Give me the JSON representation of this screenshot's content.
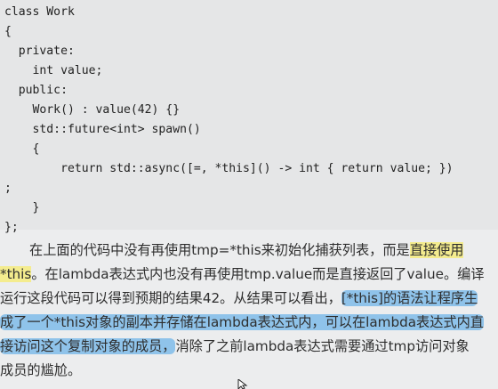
{
  "code": {
    "lines": [
      "class Work",
      "{",
      "  private:",
      "    int value;",
      "  public:",
      "    Work() : value(42) {}",
      "    std::future<int> spawn()",
      "    {",
      "        return std::async([=, *this]() -> int { return value; })",
      ";",
      "    }",
      "};"
    ]
  },
  "paragraph": {
    "l1_a": "在上面的代码中没有再使用tmp=*this来初始化捕获列表，而是",
    "l1_hl": "直接使用",
    "l2_hl": "*this",
    "l2_b": "。在lambda表达式内也没有再使用tmp.value而是直接返回了value。编译",
    "l3_a": "运行这段代码可以得到预期的结果42。从结果可以看出，",
    "l3_hl": "[*this]的语法让程序生",
    "l4_hl": "成了一个*this对象的副本并存储在lambda表达式内，可以在lambda表达式内直",
    "l5_hl": "接访问这个复制对象的成员，",
    "l5_b": "消除了之前lambda表达式需要通过tmp访问对象",
    "l6_a": "成员的尴尬。"
  },
  "colors": {
    "yellow_highlight": "#f4ec8e",
    "blue_highlight": "#8fc3ea",
    "background": "#ecedee"
  },
  "icons": {
    "cursor": "mouse-cursor-icon"
  }
}
